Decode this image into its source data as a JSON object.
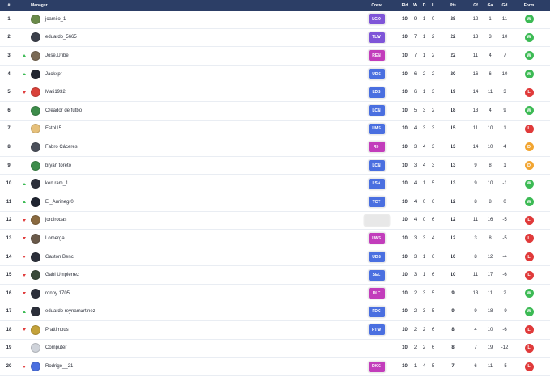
{
  "header": {
    "rank": "#",
    "manager": "Manager",
    "crew": "Crew",
    "pld": "Pld",
    "w": "W",
    "d": "D",
    "l": "L",
    "pts": "Pts",
    "gf": "Gf",
    "ga": "Ga",
    "gd": "Gd",
    "form": "Form"
  },
  "colors": {
    "header_bg": "#2c3e66",
    "trend_up": "#3cba54",
    "trend_down": "#e03a3a",
    "form_win": "#3cba54",
    "form_loss": "#e03a3a",
    "form_draw": "#f2a531"
  },
  "rows": [
    {
      "rank": "1",
      "trend": "none",
      "name": "jcamilo_1",
      "avatar": "#6a8a4a",
      "crew": "LGO",
      "crew_color": "#7f55d8",
      "pld": "10",
      "w": "9",
      "d": "1",
      "l": "0",
      "pts": "28",
      "gf": "12",
      "ga": "1",
      "gd": "11",
      "form": "W",
      "form_color": "#3cba54"
    },
    {
      "rank": "2",
      "trend": "none",
      "name": "eduardo_5665",
      "avatar": "#3b3f4a",
      "crew": "TLW",
      "crew_color": "#7f55d8",
      "pld": "10",
      "w": "7",
      "d": "1",
      "l": "2",
      "pts": "22",
      "gf": "13",
      "ga": "3",
      "gd": "10",
      "form": "W",
      "form_color": "#3cba54"
    },
    {
      "rank": "3",
      "trend": "up",
      "name": "Jose.Uribe",
      "avatar": "#7a6a55",
      "crew": "REN",
      "crew_color": "#c23dbb",
      "pld": "10",
      "w": "7",
      "d": "1",
      "l": "2",
      "pts": "22",
      "gf": "11",
      "ga": "4",
      "gd": "7",
      "form": "W",
      "form_color": "#3cba54"
    },
    {
      "rank": "4",
      "trend": "up",
      "name": "Jackxpr",
      "avatar": "#222631",
      "crew": "UDS",
      "crew_color": "#4a6fe0",
      "pld": "10",
      "w": "6",
      "d": "2",
      "l": "2",
      "pts": "20",
      "gf": "16",
      "ga": "6",
      "gd": "10",
      "form": "W",
      "form_color": "#3cba54"
    },
    {
      "rank": "5",
      "trend": "down",
      "name": "Mati1932",
      "avatar": "#d9423a",
      "crew": "LDS",
      "crew_color": "#4a6fe0",
      "pld": "10",
      "w": "6",
      "d": "1",
      "l": "3",
      "pts": "19",
      "gf": "14",
      "ga": "11",
      "gd": "3",
      "form": "L",
      "form_color": "#e03a3a"
    },
    {
      "rank": "6",
      "trend": "none",
      "name": "Creador de futbol",
      "avatar": "#3d8c4a",
      "crew": "LCN",
      "crew_color": "#4a6fe0",
      "pld": "10",
      "w": "5",
      "d": "3",
      "l": "2",
      "pts": "18",
      "gf": "13",
      "ga": "4",
      "gd": "9",
      "form": "W",
      "form_color": "#3cba54"
    },
    {
      "rank": "7",
      "trend": "none",
      "name": "Estol15",
      "avatar": "#e6c07a",
      "crew": "LMS",
      "crew_color": "#4a6fe0",
      "pld": "10",
      "w": "4",
      "d": "3",
      "l": "3",
      "pts": "15",
      "gf": "11",
      "ga": "10",
      "gd": "1",
      "form": "L",
      "form_color": "#e03a3a"
    },
    {
      "rank": "8",
      "trend": "none",
      "name": "Fabro Cáceres",
      "avatar": "#4a4f5a",
      "crew": "RH",
      "crew_color": "#c23dbb",
      "pld": "10",
      "w": "3",
      "d": "4",
      "l": "3",
      "pts": "13",
      "gf": "14",
      "ga": "10",
      "gd": "4",
      "form": "D",
      "form_color": "#f2a531"
    },
    {
      "rank": "9",
      "trend": "none",
      "name": "bryan toreto",
      "avatar": "#3d8c4a",
      "crew": "LCN",
      "crew_color": "#4a6fe0",
      "pld": "10",
      "w": "3",
      "d": "4",
      "l": "3",
      "pts": "13",
      "gf": "9",
      "ga": "8",
      "gd": "1",
      "form": "D",
      "form_color": "#f2a531"
    },
    {
      "rank": "10",
      "trend": "up",
      "name": "ken ram_1",
      "avatar": "#2b2f3a",
      "crew": "LSA",
      "crew_color": "#4a6fe0",
      "pld": "10",
      "w": "4",
      "d": "1",
      "l": "5",
      "pts": "13",
      "gf": "9",
      "ga": "10",
      "gd": "-1",
      "form": "W",
      "form_color": "#3cba54"
    },
    {
      "rank": "11",
      "trend": "up",
      "name": "El_Aurinegr0",
      "avatar": "#1f2430",
      "crew": "TCT",
      "crew_color": "#4a6fe0",
      "pld": "10",
      "w": "4",
      "d": "0",
      "l": "6",
      "pts": "12",
      "gf": "8",
      "ga": "8",
      "gd": "0",
      "form": "W",
      "form_color": "#3cba54"
    },
    {
      "rank": "12",
      "trend": "down",
      "name": "jordirodas",
      "avatar": "#8a6a40",
      "crew": "",
      "crew_color": "",
      "pld": "10",
      "w": "4",
      "d": "0",
      "l": "6",
      "pts": "12",
      "gf": "11",
      "ga": "16",
      "gd": "-5",
      "form": "L",
      "form_color": "#e03a3a"
    },
    {
      "rank": "13",
      "trend": "down",
      "name": "Lomerga",
      "avatar": "#6a5a4a",
      "crew": "LWS",
      "crew_color": "#c23dbb",
      "pld": "10",
      "w": "3",
      "d": "3",
      "l": "4",
      "pts": "12",
      "gf": "3",
      "ga": "8",
      "gd": "-5",
      "form": "L",
      "form_color": "#e03a3a"
    },
    {
      "rank": "14",
      "trend": "down",
      "name": "Gaston Benci",
      "avatar": "#2b2f3a",
      "crew": "UDS",
      "crew_color": "#4a6fe0",
      "pld": "10",
      "w": "3",
      "d": "1",
      "l": "6",
      "pts": "10",
      "gf": "8",
      "ga": "12",
      "gd": "-4",
      "form": "L",
      "form_color": "#e03a3a"
    },
    {
      "rank": "15",
      "trend": "down",
      "name": "Gabi Umpierrez",
      "avatar": "#3a4a3a",
      "crew": "SEL",
      "crew_color": "#4a6fe0",
      "pld": "10",
      "w": "3",
      "d": "1",
      "l": "6",
      "pts": "10",
      "gf": "11",
      "ga": "17",
      "gd": "-6",
      "form": "L",
      "form_color": "#e03a3a"
    },
    {
      "rank": "16",
      "trend": "down",
      "name": "ronny 1705",
      "avatar": "#2b2f3a",
      "crew": "DLT",
      "crew_color": "#c23dbb",
      "pld": "10",
      "w": "2",
      "d": "3",
      "l": "5",
      "pts": "9",
      "gf": "13",
      "ga": "11",
      "gd": "2",
      "form": "W",
      "form_color": "#3cba54"
    },
    {
      "rank": "17",
      "trend": "up",
      "name": "eduardo reynamartinez",
      "avatar": "#2b2f3a",
      "crew": "FDC",
      "crew_color": "#4a6fe0",
      "pld": "10",
      "w": "2",
      "d": "3",
      "l": "5",
      "pts": "9",
      "gf": "9",
      "ga": "18",
      "gd": "-9",
      "form": "W",
      "form_color": "#3cba54"
    },
    {
      "rank": "18",
      "trend": "down",
      "name": "Prattimous",
      "avatar": "#c4a23a",
      "crew": "PTW",
      "crew_color": "#4a6fe0",
      "pld": "10",
      "w": "2",
      "d": "2",
      "l": "6",
      "pts": "8",
      "gf": "4",
      "ga": "10",
      "gd": "-6",
      "form": "L",
      "form_color": "#e03a3a"
    },
    {
      "rank": "19",
      "trend": "none",
      "name": "Computer",
      "avatar": "#cfd3da",
      "crew": "",
      "crew_color": "",
      "pld": "10",
      "w": "2",
      "d": "2",
      "l": "6",
      "pts": "8",
      "gf": "7",
      "ga": "19",
      "gd": "-12",
      "form": "L",
      "form_color": "#e03a3a"
    },
    {
      "rank": "20",
      "trend": "down",
      "name": "Rodrigo__21",
      "avatar": "#4a6fe0",
      "crew": "DKG",
      "crew_color": "#c23dbb",
      "pld": "10",
      "w": "1",
      "d": "4",
      "l": "5",
      "pts": "7",
      "gf": "6",
      "ga": "11",
      "gd": "-5",
      "form": "L",
      "form_color": "#e03a3a"
    }
  ]
}
